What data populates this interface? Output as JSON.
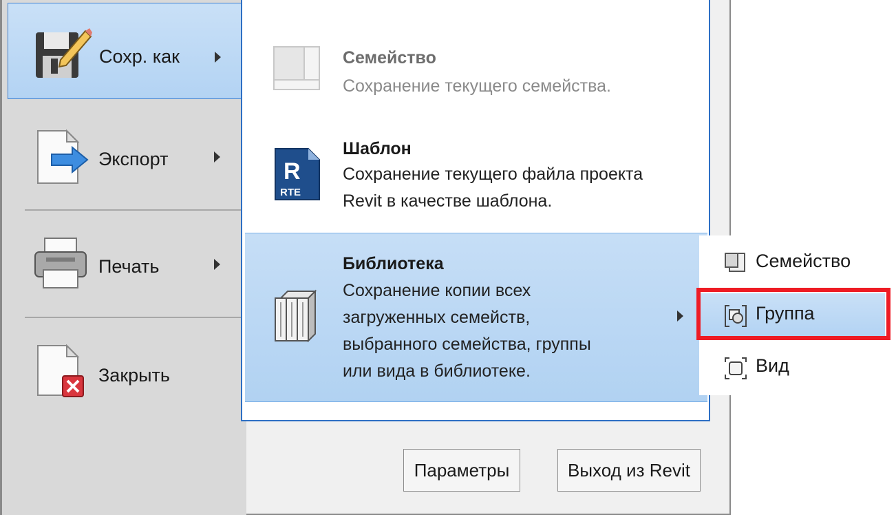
{
  "left_menu": {
    "items": [
      {
        "label": "Сохр. как",
        "icon": "save-as-icon"
      },
      {
        "label": "Экспорт",
        "icon": "export-icon"
      },
      {
        "label": "Печать",
        "icon": "print-icon"
      },
      {
        "label": "Закрыть",
        "icon": "close-document-icon"
      }
    ]
  },
  "submenu": {
    "items": [
      {
        "title": "Семейство",
        "desc": [
          "Сохранение текущего семейства."
        ],
        "icon": "family-icon",
        "state": "disabled"
      },
      {
        "title": "Шаблон",
        "desc": [
          "Сохранение текущего файла проекта",
          "Revit в качестве шаблона."
        ],
        "icon": "rte-template-icon",
        "icon_text": "RTE",
        "state": "normal"
      },
      {
        "title": "Библиотека",
        "desc": [
          "Сохранение копии всех",
          "загруженных семейств,",
          "выбранного семейства, группы",
          "или вида в библиотеке."
        ],
        "icon": "library-books-icon",
        "state": "active"
      }
    ]
  },
  "flyout": {
    "items": [
      {
        "label": "Семейство",
        "icon": "family-small-icon"
      },
      {
        "label": "Группа",
        "icon": "group-icon",
        "highlighted": true
      },
      {
        "label": "Вид",
        "icon": "view-icon"
      }
    ]
  },
  "footer": {
    "options_label": "Параметры",
    "exit_label": "Выход из Revit"
  },
  "colors": {
    "accent_border": "#2d6fc4",
    "highlight_fill": "#b3d3f3",
    "annotation_red": "#ee1b24"
  }
}
